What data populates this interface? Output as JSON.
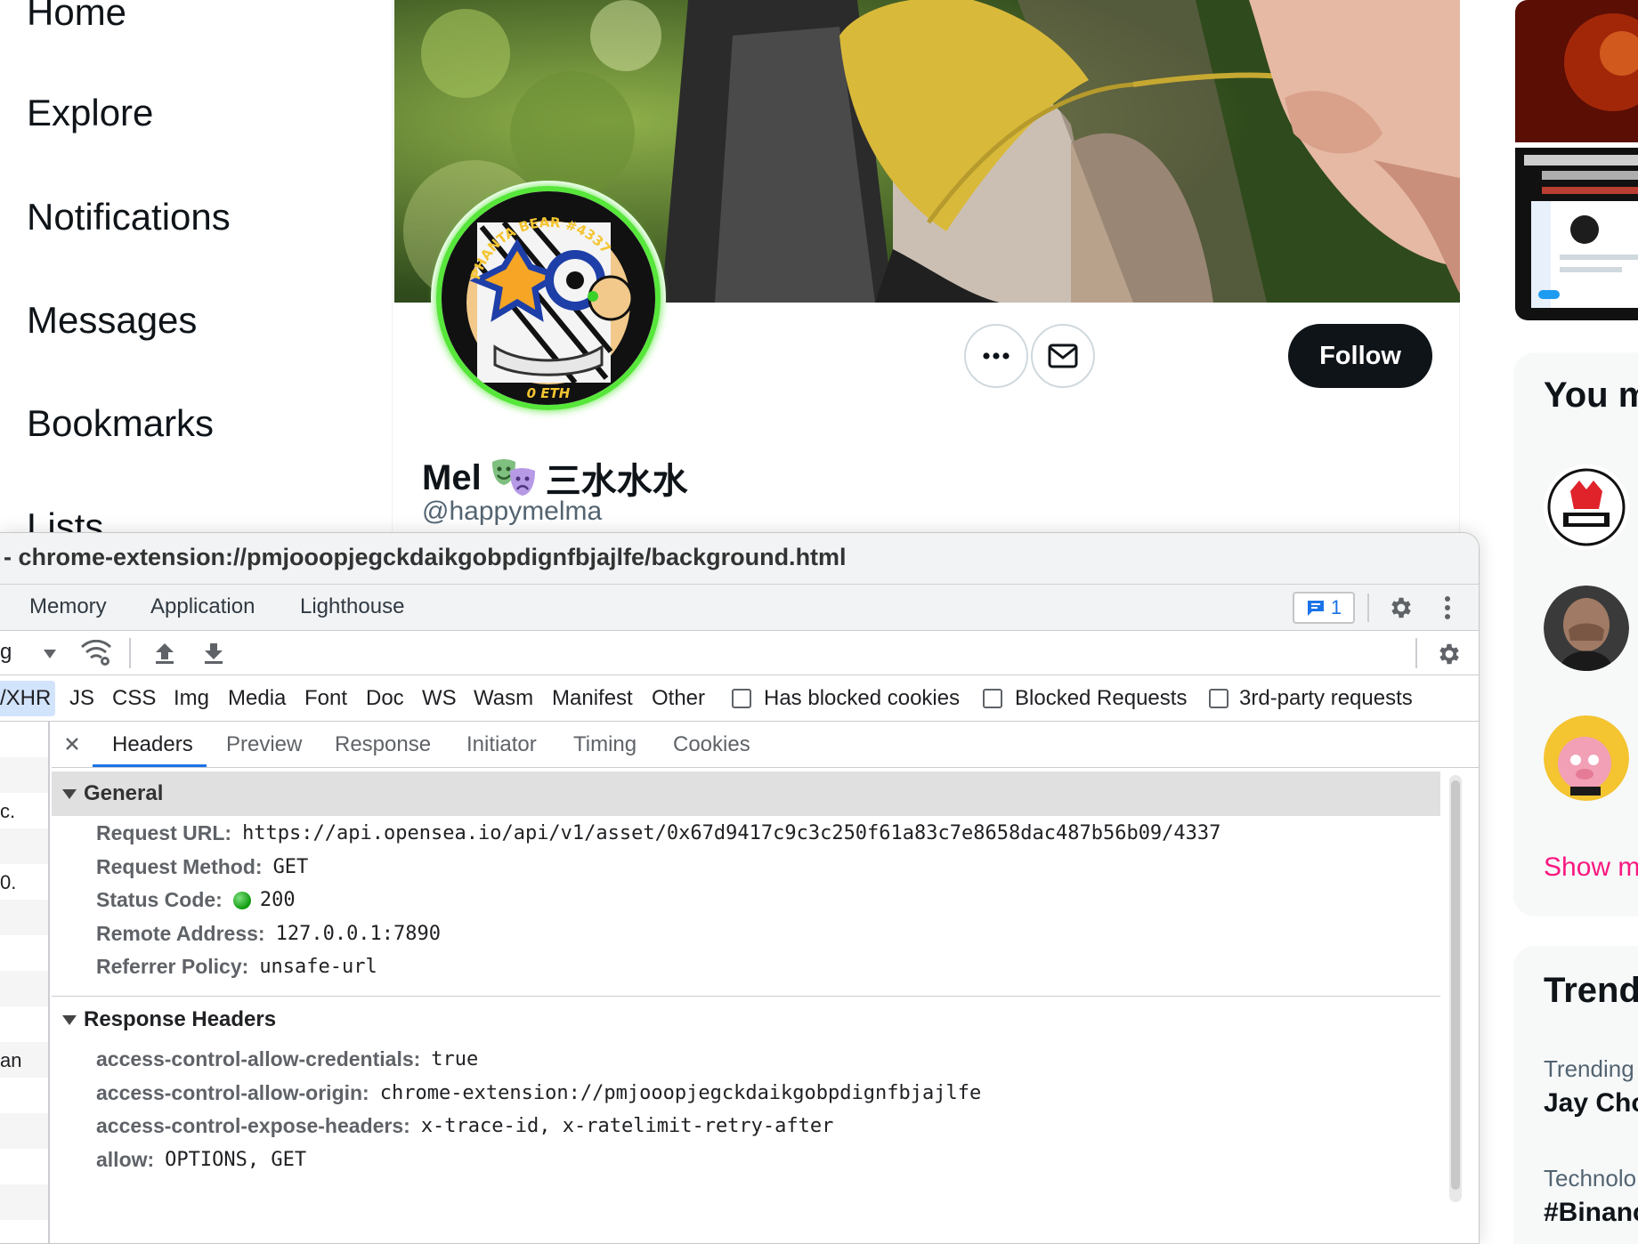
{
  "nav": {
    "home": "Home",
    "explore": "Explore",
    "notifications": "Notifications",
    "messages": "Messages",
    "bookmarks": "Bookmarks",
    "lists": "Lists"
  },
  "profile": {
    "display_name": "Mel",
    "display_name_suffix": "三水水水",
    "handle": "@happymelma",
    "follow_label": "Follow",
    "avatar_ring_text": "PHANTA BEAR #4337",
    "avatar_price_text": "0 ETH",
    "colors": {
      "follow_bg": "#0f1419",
      "avatar_ring": "#57e63a"
    }
  },
  "right": {
    "you_might_like_title": "You m",
    "show_more": "Show m",
    "trends_title": "Trend",
    "trends": [
      {
        "category": "Trending",
        "name": "Jay Cho"
      },
      {
        "category": "Technolo",
        "name": "#Binanc"
      }
    ],
    "colors": {
      "show_more": "#f91880"
    }
  },
  "devtools": {
    "title": "- chrome-extension://pmjooopjegckdaikgobpdignfbjajlfe/background.html",
    "tabs": [
      "Memory",
      "Application",
      "Lighthouse"
    ],
    "issues_count": "1",
    "toolbar": {
      "throttle_partial": "g"
    },
    "filters": {
      "types": [
        "/XHR",
        "JS",
        "CSS",
        "Img",
        "Media",
        "Font",
        "Doc",
        "WS",
        "Wasm",
        "Manifest",
        "Other"
      ],
      "checkboxes": [
        "Has blocked cookies",
        "Blocked Requests",
        "3rd-party requests"
      ]
    },
    "request_list_partial": [
      "c.",
      "0.",
      "an"
    ],
    "detail_tabs": [
      "Headers",
      "Preview",
      "Response",
      "Initiator",
      "Timing",
      "Cookies"
    ],
    "active_detail_tab": "Headers",
    "general": {
      "title": "General",
      "rows": [
        {
          "key": "Request URL:",
          "value": "https://api.opensea.io/api/v1/asset/0x67d9417c9c3c250f61a83c7e8658dac487b56b09/4337"
        },
        {
          "key": "Request Method:",
          "value": "GET"
        },
        {
          "key": "Status Code:",
          "value": "200"
        },
        {
          "key": "Remote Address:",
          "value": "127.0.0.1:7890"
        },
        {
          "key": "Referrer Policy:",
          "value": "unsafe-url"
        }
      ]
    },
    "response_headers": {
      "title": "Response Headers",
      "rows": [
        {
          "key": "access-control-allow-credentials:",
          "value": "true"
        },
        {
          "key": "access-control-allow-origin:",
          "value": "chrome-extension://pmjooopjegckdaikgobpdignfbjajlfe"
        },
        {
          "key": "access-control-expose-headers:",
          "value": "x-trace-id, x-ratelimit-retry-after"
        },
        {
          "key": "allow:",
          "value": "OPTIONS, GET"
        }
      ]
    },
    "colors": {
      "accent": "#1a73e8",
      "status_ok": "#0d9a0d"
    }
  }
}
